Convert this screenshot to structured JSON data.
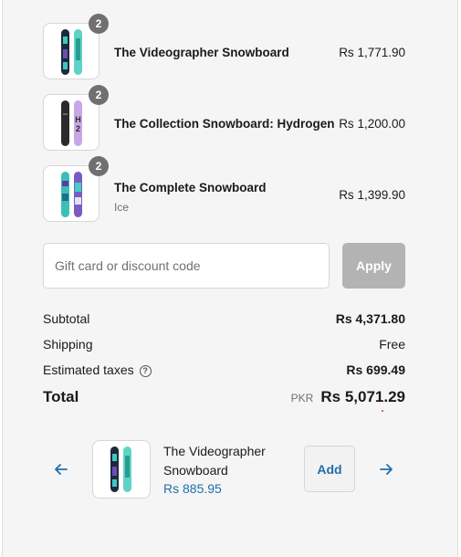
{
  "line_items": [
    {
      "name": "The Videographer Snowboard",
      "variant": "",
      "price": "Rs 1,771.90",
      "quantity": "2",
      "icon": "snowboard-image"
    },
    {
      "name": "The Collection Snowboard: Hydrogen",
      "variant": "",
      "price": "Rs 1,200.00",
      "quantity": "2",
      "icon": "snowboard-image"
    },
    {
      "name": "The Complete Snowboard",
      "variant": "Ice",
      "price": "Rs 1,399.90",
      "quantity": "2",
      "icon": "snowboard-image"
    }
  ],
  "discount": {
    "placeholder": "Gift card or discount code",
    "value": "",
    "apply_label": "Apply"
  },
  "summary": {
    "subtotal_label": "Subtotal",
    "subtotal_value": "Rs 4,371.80",
    "shipping_label": "Shipping",
    "shipping_value": "Free",
    "taxes_label": "Estimated taxes",
    "taxes_value": "Rs 699.49",
    "total_label": "Total",
    "total_currency": "PKR",
    "total_value": "Rs 5,071.29"
  },
  "upsell": {
    "title": "The Videographer Snowboard",
    "price": "Rs 885.95",
    "add_label": "Add"
  },
  "colors": {
    "accent": "#1f6eab",
    "badge": "#707070",
    "apply_disabled": "#b3b3b3",
    "panel_bg": "#f5f5f5"
  }
}
